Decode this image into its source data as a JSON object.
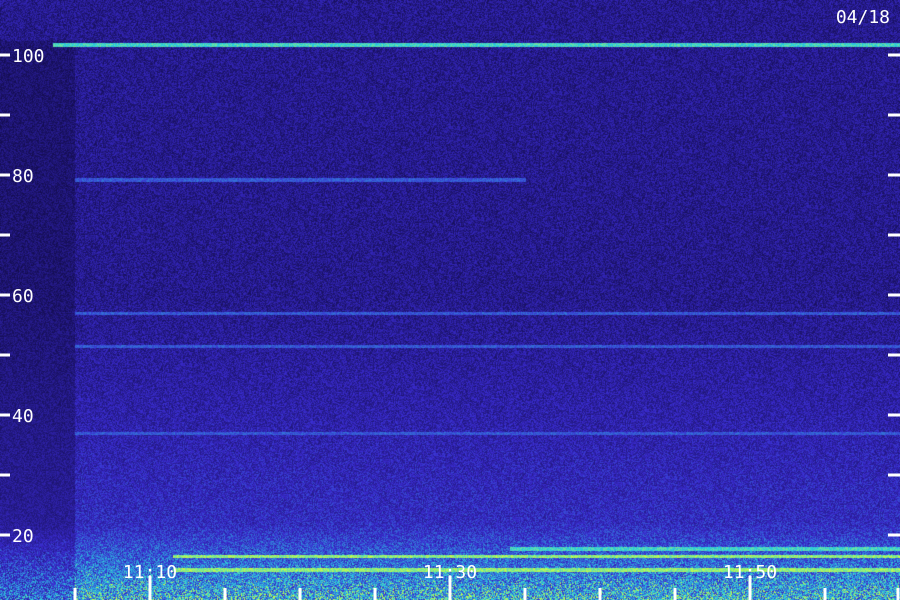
{
  "date_label": "04/18",
  "chart_data": {
    "type": "heatmap",
    "title": "",
    "xlabel": "",
    "ylabel": "",
    "ylim": [
      14,
      104
    ],
    "y_ticks_labeled": [
      "100",
      "80",
      "60",
      "40",
      "20"
    ],
    "y_tick_values_labeled": [
      100,
      80,
      60,
      40,
      20
    ],
    "y_tick_values_minor": [
      90,
      70,
      50,
      30
    ],
    "x_tick_labels": [
      "11:10",
      "11:30",
      "11:50"
    ],
    "x_tick_minutes": [
      10,
      30,
      50
    ],
    "x_range_minutes": [
      0,
      60
    ],
    "x_minor_tick_minutes": [
      5,
      15,
      20,
      25,
      35,
      40,
      45,
      55,
      60
    ],
    "colors": {
      "background": "#1a0f5a",
      "low": "#0a0530",
      "mid": "#3a2bd0",
      "high": "#2ad0e0",
      "peak": "#d0ff40",
      "axis": "#ffffff"
    },
    "bands": [
      {
        "y": 101.8,
        "start_min": 3.5,
        "end_min": 60,
        "level": "high"
      },
      {
        "y": 79.2,
        "start_min": 5,
        "end_min": 35,
        "level": "mid"
      },
      {
        "y": 57,
        "start_min": 5,
        "end_min": 60,
        "level": "mid"
      },
      {
        "y": 51.5,
        "start_min": 5,
        "end_min": 60,
        "level": "mid"
      },
      {
        "y": 37,
        "start_min": 5,
        "end_min": 60,
        "level": "mid"
      },
      {
        "y": 16.5,
        "start_min": 11.5,
        "end_min": 60,
        "level": "peak"
      },
      {
        "y": 17.8,
        "start_min": 34,
        "end_min": 60,
        "level": "high"
      },
      {
        "y": 14.2,
        "start_min": 11.5,
        "end_min": 60,
        "level": "peak"
      }
    ]
  }
}
